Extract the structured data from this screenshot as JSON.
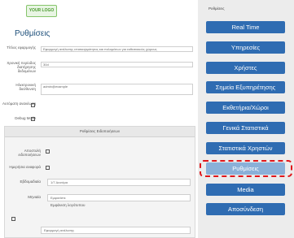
{
  "logo": {
    "text": "YOUR LOGO"
  },
  "page": {
    "title": "Ρυθμίσεις"
  },
  "form": {
    "rows": [
      {
        "label": "Τίτλος εφαρμογής",
        "value": "Εφαρμογή ανάλυσης επισκεψιμότητας και πολυμέσων για εκθεσιακούς χώρους"
      },
      {
        "label": "Χρονική περίοδος διατήρησης δεδομένων",
        "value": "30d"
      },
      {
        "label": "Ηλεκτρονική διεύθυνση",
        "value": "admin@example"
      },
      {
        "label": "Αυτόματη ανανέωση",
        "value": ""
      },
      {
        "label": "Debug Mode",
        "value": ""
      }
    ]
  },
  "panel": {
    "title": "Ρυθμίσεις Ειδοποιήσεων",
    "rows": [
      {
        "label": "Αποστολή ειδοποιήσεων"
      },
      {
        "label": "Ημερήσια αναφορά"
      },
      {
        "label": "Εβδομαδιαία",
        "value": "1/7 Δευτέρα"
      },
      {
        "label": "Μηνιαία",
        "value": "Εμφανίστε"
      }
    ],
    "sublabel": "Εμφάνιση λογότυπου",
    "bottom_value": "Εφαρμογή ανάλυσης"
  },
  "sidebar": {
    "title": "Ρυθμίσεις",
    "items": [
      {
        "label": "Real Time"
      },
      {
        "label": "Υπηρεσίες"
      },
      {
        "label": "Χρήστες"
      },
      {
        "label": "Σημεία Εξυπηρέτησης"
      },
      {
        "label": "Εκθετήρια/Χώροι"
      },
      {
        "label": "Γενικά Στατιστικά"
      },
      {
        "label": "Στατιστικά Χρηστών"
      },
      {
        "label": "Ρυθμίσεις"
      },
      {
        "label": "Media"
      },
      {
        "label": "Αποσύνδεση"
      }
    ]
  }
}
